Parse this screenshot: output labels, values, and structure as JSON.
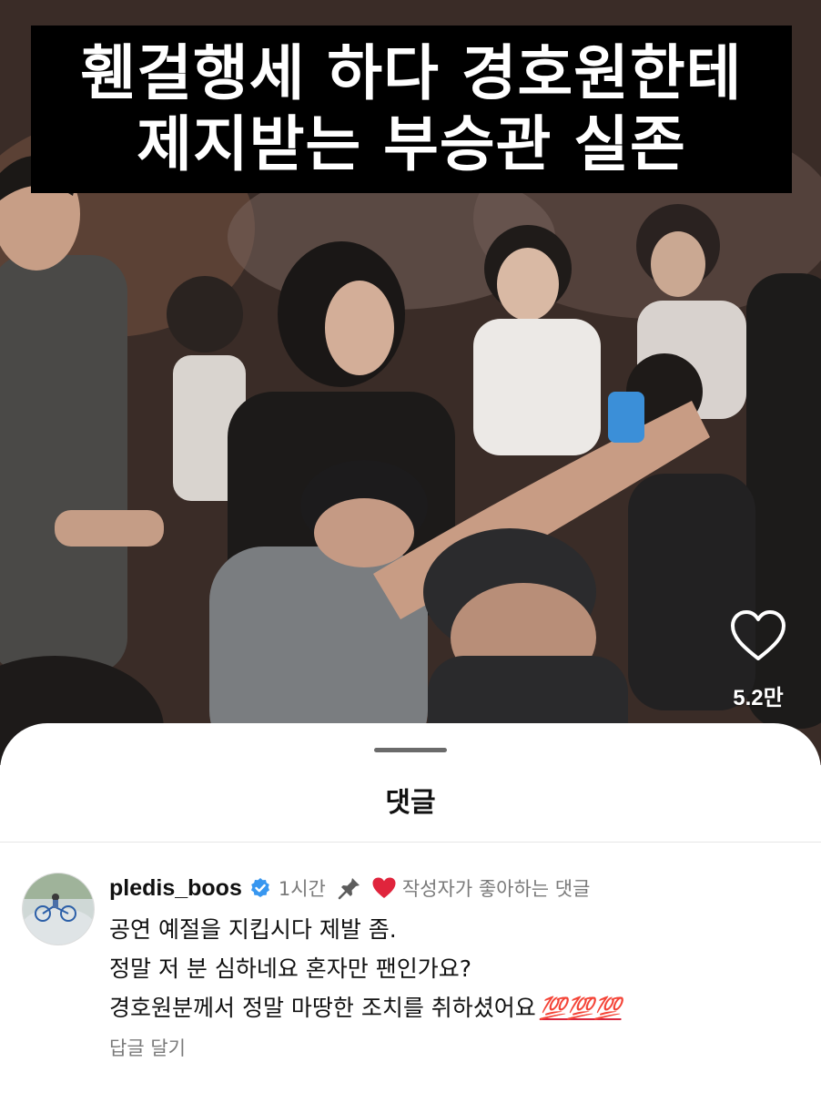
{
  "video": {
    "caption_lines": [
      "휀걸행세 하다 경호원한테",
      "제지받는 부승관 실존"
    ],
    "like_icon": "heart-outline-icon",
    "like_count": "5.2만"
  },
  "comments_sheet": {
    "title": "댓글",
    "comment": {
      "avatar_icon": "avatar-icon",
      "username": "pledis_boos",
      "verified_icon": "verified-badge-icon",
      "time": "1시간",
      "pin_icon": "pin-icon",
      "author_heart_icon": "red-heart-icon",
      "author_liked_label": "작성자가 좋아하는 댓글",
      "lines": [
        "공연 예절을 지킵시다 제발 좀.",
        "정말 저 분 심하네요 혼자만 팬인가요?",
        "경호원분께서 정말 마땅한 조치를 취하셨어요"
      ],
      "emoji_text": "💯💯💯",
      "reply_label": "답글 달기"
    }
  },
  "colors": {
    "caption_background": "#000000",
    "caption_text": "#ffffff",
    "verified_blue": "#3897f0",
    "heart_red": "#e0243c",
    "secondary_text": "#7a7a7a"
  }
}
